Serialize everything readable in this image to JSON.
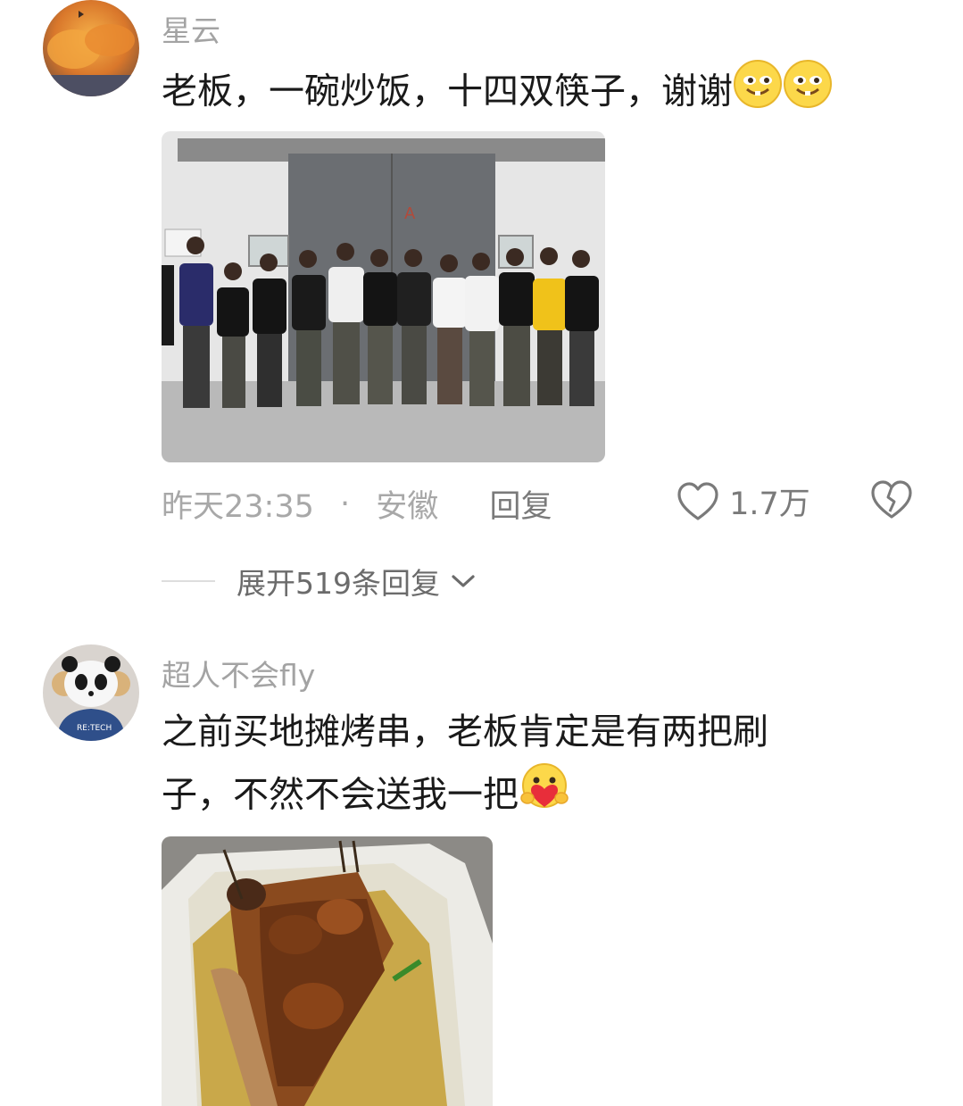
{
  "comments": [
    {
      "username": "星云",
      "text": "老板，一碗炒饭，十四双筷子，谢谢",
      "emojis": [
        "smirk-face-emoji",
        "smirk-face-emoji"
      ],
      "image": "photo-group-of-young-men-standing-in-line",
      "time": "昨天23:35",
      "separator": "·",
      "location": "安徽",
      "reply_label": "回复",
      "likes": "1.7万",
      "expand_label": "展开519条回复"
    },
    {
      "username": "超人不会fly",
      "text_line1": "之前买地摊烤串，老板肯定是有两把刷",
      "text_line2": "子，不然不会送我一把",
      "emojis": [
        "heart-hug-face-emoji"
      ],
      "image": "photo-grilled-skewers-in-foam-box"
    }
  ],
  "colors": {
    "username": "#a3a3a3",
    "text": "#1a1a1a",
    "meta": "#a8a8a8",
    "action": "#7a7a7a"
  }
}
